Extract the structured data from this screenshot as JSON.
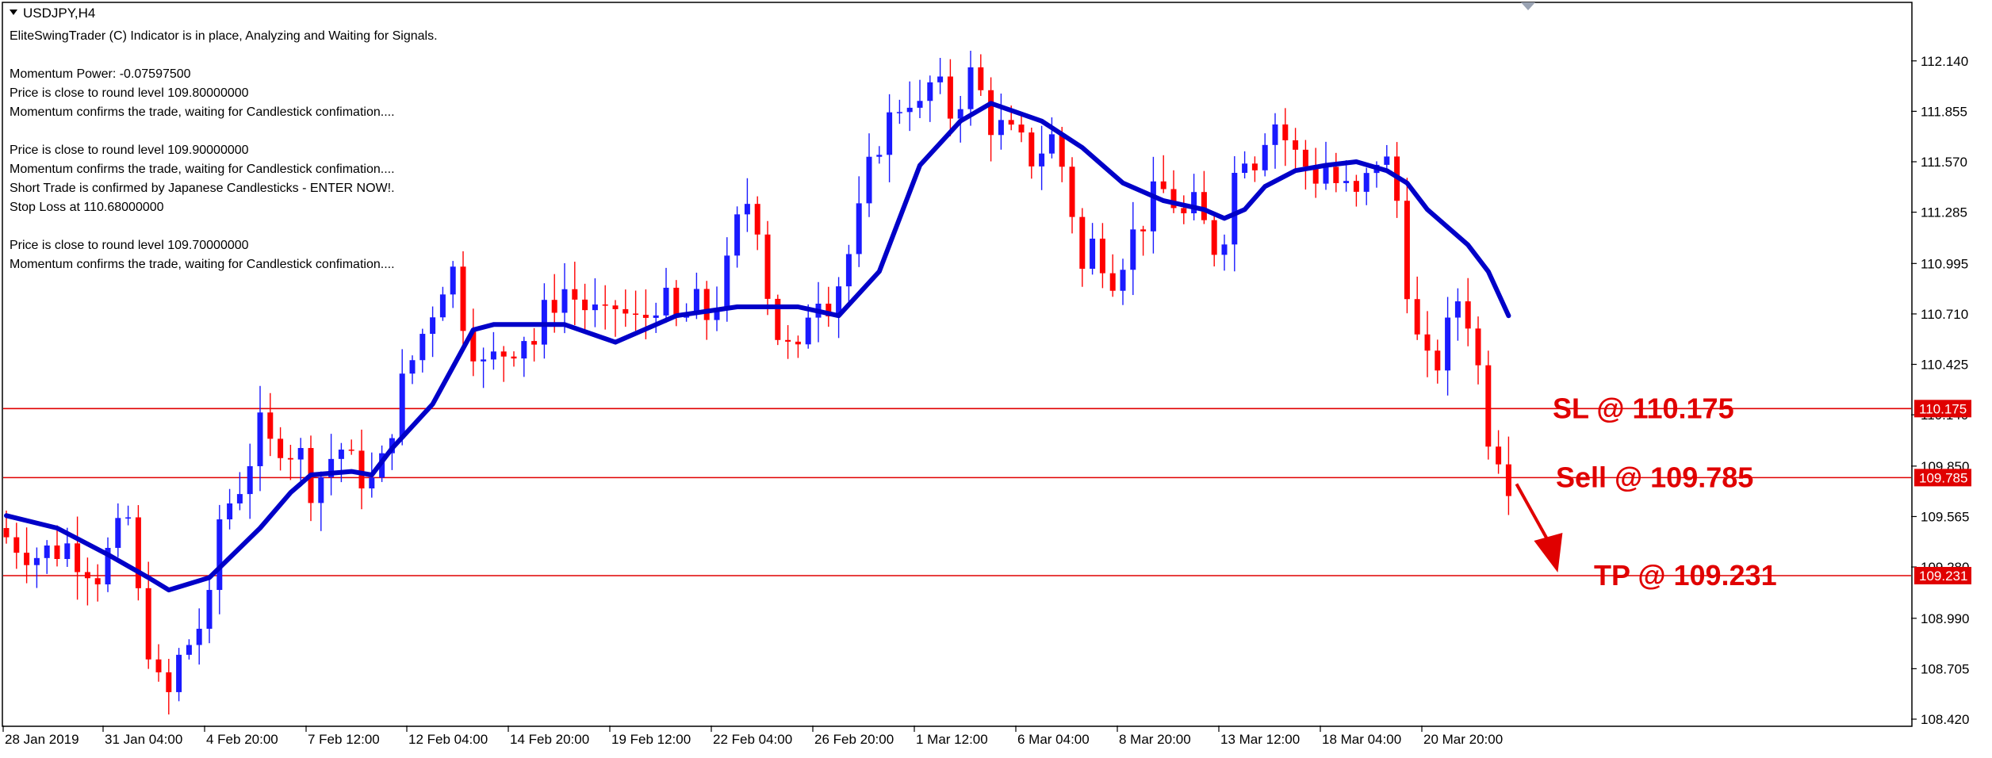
{
  "window": {
    "symbol_title": "USDJPY,H4"
  },
  "info": {
    "lines": [
      "EliteSwingTrader (C) Indicator is in place, Analyzing and Waiting for Signals.",
      "",
      "Momentum Power: -0.07597500",
      "Price is close to round level 109.80000000",
      "Momentum confirms the trade, waiting for Candlestick confimation....",
      "",
      "Price is close to round level 109.90000000",
      "Momentum confirms the trade, waiting for Candlestick confimation....",
      "Short Trade is confirmed by Japanese Candlesticks - ENTER NOW!.",
      "Stop Loss at 110.68000000",
      "",
      "Price is close to round level 109.70000000",
      "Momentum confirms the trade, waiting for Candlestick confimation...."
    ]
  },
  "colors": {
    "bull": "#1a1aff",
    "bear": "#ff0000",
    "ma": "#0000c8",
    "level_line": "#e00000",
    "annotation": "#e00000",
    "axis": "#000000",
    "price_tag_bg": "#e00000",
    "price_tag_text": "#ffffff"
  },
  "chart_data": {
    "type": "candlestick",
    "title": "USDJPY,H4",
    "ylim": [
      108.42,
      112.26
    ],
    "y_ticks": [
      "112.140",
      "111.855",
      "111.570",
      "111.285",
      "110.995",
      "110.710",
      "110.425",
      "110.140",
      "109.850",
      "109.565",
      "109.280",
      "108.990",
      "108.705",
      "108.420"
    ],
    "x_ticks": [
      "28 Jan 2019",
      "31 Jan 04:00",
      "4 Feb 20:00",
      "7 Feb 12:00",
      "12 Feb 04:00",
      "14 Feb 20:00",
      "19 Feb 12:00",
      "22 Feb 04:00",
      "26 Feb 20:00",
      "1 Mar 12:00",
      "6 Mar 04:00",
      "8 Mar 20:00",
      "13 Mar 12:00",
      "18 Mar 04:00",
      "20 Mar 20:00"
    ],
    "close_path": [
      [
        0,
        109.45
      ],
      [
        3,
        109.35
      ],
      [
        6,
        109.4
      ],
      [
        9,
        109.25
      ],
      [
        11,
        109.45
      ],
      [
        12,
        109.55
      ],
      [
        13,
        109.1
      ],
      [
        14,
        108.85
      ],
      [
        15,
        108.6
      ],
      [
        16,
        108.55
      ],
      [
        17,
        108.75
      ],
      [
        18,
        108.85
      ],
      [
        19,
        108.95
      ],
      [
        20,
        109.05
      ],
      [
        21,
        109.55
      ],
      [
        22,
        109.65
      ],
      [
        23,
        109.75
      ],
      [
        24,
        109.9
      ],
      [
        25,
        110.05
      ],
      [
        26,
        109.95
      ],
      [
        27,
        110.0
      ],
      [
        28,
        109.95
      ],
      [
        29,
        109.9
      ],
      [
        30,
        109.75
      ],
      [
        31,
        109.8
      ],
      [
        32,
        109.9
      ],
      [
        33,
        109.95
      ],
      [
        34,
        109.85
      ],
      [
        35,
        109.8
      ],
      [
        36,
        109.75
      ],
      [
        37,
        109.85
      ],
      [
        38,
        110.1
      ],
      [
        39,
        110.3
      ],
      [
        40,
        110.45
      ],
      [
        41,
        110.6
      ],
      [
        42,
        110.75
      ],
      [
        43,
        110.9
      ],
      [
        44,
        110.95
      ],
      [
        45,
        110.7
      ],
      [
        46,
        110.55
      ],
      [
        47,
        110.4
      ],
      [
        48,
        110.45
      ],
      [
        49,
        110.5
      ],
      [
        50,
        110.55
      ],
      [
        51,
        110.6
      ],
      [
        52,
        110.55
      ],
      [
        53,
        110.7
      ],
      [
        54,
        110.8
      ],
      [
        55,
        110.85
      ],
      [
        56,
        110.8
      ],
      [
        57,
        110.75
      ],
      [
        58,
        110.7
      ],
      [
        59,
        110.65
      ],
      [
        60,
        110.75
      ],
      [
        61,
        110.7
      ],
      [
        62,
        110.65
      ],
      [
        63,
        110.7
      ],
      [
        64,
        110.8
      ],
      [
        65,
        110.75
      ],
      [
        66,
        110.65
      ],
      [
        67,
        110.7
      ],
      [
        68,
        110.75
      ],
      [
        69,
        110.7
      ],
      [
        70,
        110.8
      ],
      [
        71,
        110.95
      ],
      [
        72,
        111.2
      ],
      [
        73,
        111.35
      ],
      [
        74,
        111.25
      ],
      [
        75,
        110.85
      ],
      [
        76,
        110.6
      ],
      [
        77,
        110.5
      ],
      [
        78,
        110.45
      ],
      [
        79,
        110.75
      ],
      [
        80,
        110.85
      ],
      [
        81,
        110.8
      ],
      [
        82,
        110.9
      ],
      [
        83,
        111.05
      ],
      [
        84,
        111.25
      ],
      [
        85,
        111.5
      ],
      [
        86,
        111.7
      ],
      [
        87,
        111.8
      ],
      [
        88,
        111.9
      ],
      [
        89,
        111.95
      ],
      [
        90,
        111.85
      ],
      [
        91,
        112.0
      ],
      [
        92,
        111.95
      ],
      [
        93,
        111.85
      ],
      [
        94,
        111.95
      ],
      [
        95,
        112.05
      ],
      [
        96,
        111.95
      ],
      [
        97,
        111.8
      ],
      [
        98,
        111.75
      ],
      [
        99,
        111.7
      ],
      [
        100,
        111.65
      ],
      [
        101,
        111.6
      ],
      [
        102,
        111.65
      ],
      [
        103,
        111.7
      ],
      [
        104,
        111.55
      ],
      [
        105,
        111.3
      ],
      [
        106,
        110.95
      ],
      [
        107,
        111.1
      ],
      [
        108,
        111.05
      ],
      [
        109,
        110.95
      ],
      [
        110,
        111.05
      ],
      [
        111,
        111.15
      ],
      [
        112,
        111.25
      ],
      [
        113,
        111.35
      ],
      [
        114,
        111.4
      ],
      [
        115,
        111.35
      ],
      [
        116,
        111.25
      ],
      [
        117,
        111.3
      ],
      [
        118,
        111.2
      ],
      [
        119,
        111.1
      ],
      [
        120,
        111.2
      ],
      [
        121,
        111.5
      ],
      [
        122,
        111.65
      ],
      [
        123,
        111.6
      ],
      [
        124,
        111.75
      ],
      [
        125,
        111.8
      ],
      [
        126,
        111.7
      ],
      [
        127,
        111.6
      ],
      [
        128,
        111.55
      ],
      [
        129,
        111.5
      ],
      [
        130,
        111.55
      ],
      [
        131,
        111.45
      ],
      [
        132,
        111.4
      ],
      [
        133,
        111.35
      ],
      [
        134,
        111.45
      ],
      [
        135,
        111.6
      ],
      [
        136,
        111.55
      ],
      [
        137,
        111.35
      ],
      [
        138,
        110.9
      ],
      [
        139,
        110.55
      ],
      [
        140,
        110.4
      ],
      [
        141,
        110.45
      ],
      [
        142,
        110.6
      ],
      [
        143,
        110.8
      ],
      [
        144,
        110.7
      ],
      [
        145,
        110.4
      ],
      [
        146,
        110.05
      ],
      [
        147,
        109.95
      ],
      [
        148,
        109.79
      ]
    ],
    "ma_path": [
      [
        0,
        109.57
      ],
      [
        5,
        109.5
      ],
      [
        10,
        109.35
      ],
      [
        14,
        109.22
      ],
      [
        16,
        109.15
      ],
      [
        20,
        109.22
      ],
      [
        25,
        109.5
      ],
      [
        28,
        109.7
      ],
      [
        30,
        109.8
      ],
      [
        34,
        109.82
      ],
      [
        36,
        109.8
      ],
      [
        38,
        109.95
      ],
      [
        42,
        110.2
      ],
      [
        46,
        110.62
      ],
      [
        48,
        110.65
      ],
      [
        55,
        110.65
      ],
      [
        60,
        110.55
      ],
      [
        66,
        110.7
      ],
      [
        72,
        110.75
      ],
      [
        78,
        110.75
      ],
      [
        82,
        110.7
      ],
      [
        86,
        110.95
      ],
      [
        90,
        111.55
      ],
      [
        94,
        111.8
      ],
      [
        97,
        111.9
      ],
      [
        102,
        111.8
      ],
      [
        106,
        111.65
      ],
      [
        110,
        111.45
      ],
      [
        114,
        111.35
      ],
      [
        118,
        111.3
      ],
      [
        120,
        111.25
      ],
      [
        122,
        111.3
      ],
      [
        124,
        111.43
      ],
      [
        127,
        111.52
      ],
      [
        130,
        111.55
      ],
      [
        133,
        111.57
      ],
      [
        136,
        111.52
      ],
      [
        138,
        111.45
      ],
      [
        140,
        111.3
      ],
      [
        144,
        111.1
      ],
      [
        146,
        110.95
      ],
      [
        148,
        110.7
      ]
    ],
    "levels": [
      {
        "value": 110.175,
        "label": "SL @ 110.175",
        "tag": "110.175"
      },
      {
        "value": 109.785,
        "label": "Sell @ 109.785",
        "tag": "109.785"
      },
      {
        "value": 109.231,
        "label": "TP @ 109.231",
        "tag": "109.231"
      }
    ],
    "bar_count": 149
  }
}
